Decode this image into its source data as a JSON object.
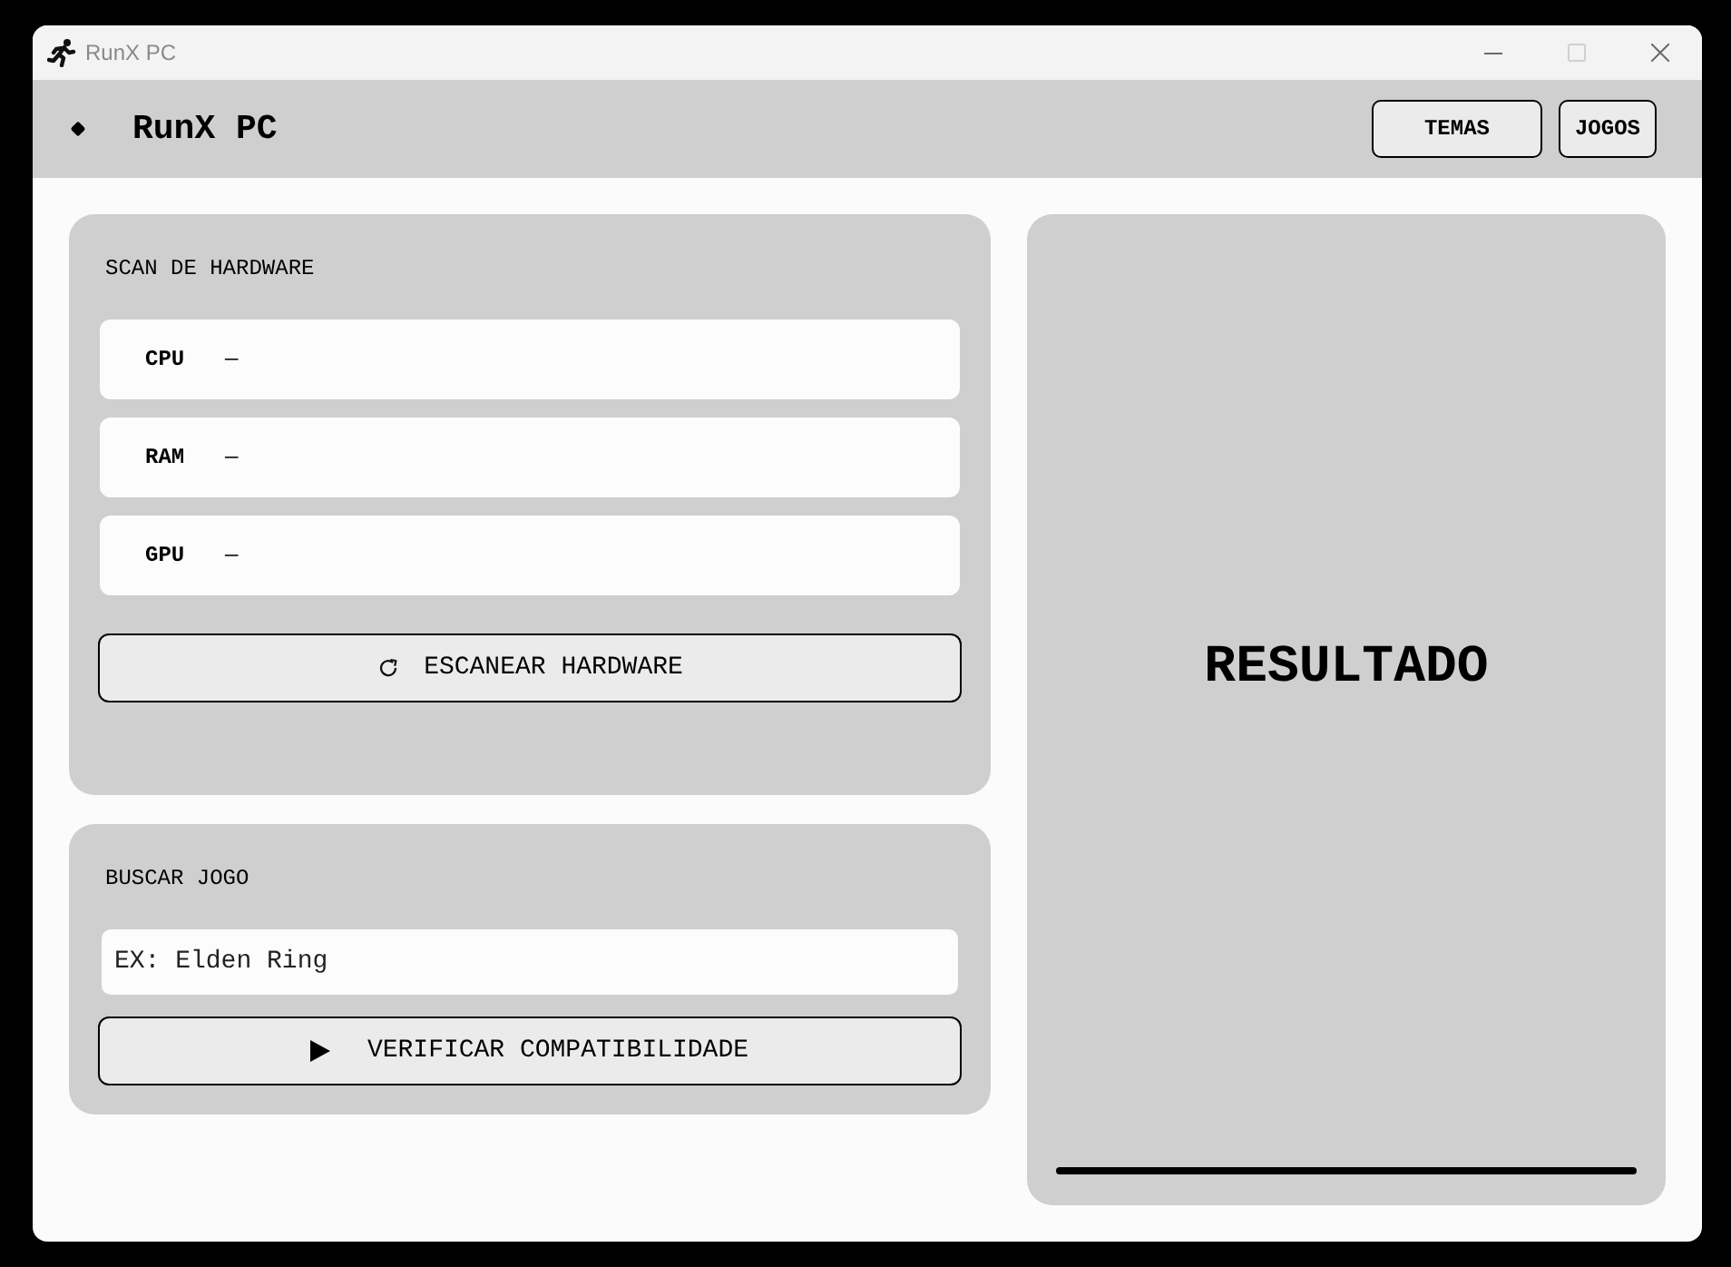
{
  "window": {
    "title": "RunX PC",
    "controls": [
      {
        "kind": "minimize",
        "disabled": false
      },
      {
        "kind": "maximize",
        "disabled": true
      },
      {
        "kind": "close",
        "disabled": false
      }
    ]
  },
  "header": {
    "title": "RunX PC",
    "buttons": [
      "TEMAS",
      "JOGOS"
    ]
  },
  "hardware_scan": {
    "title": "SCAN DE HARDWARE",
    "rows": [
      {
        "label": "CPU",
        "value": "—"
      },
      {
        "label": "RAM",
        "value": "—"
      },
      {
        "label": "GPU",
        "value": "—"
      }
    ],
    "button": "ESCANEAR HARDWARE"
  },
  "game_search": {
    "title": "BUSCAR JOGO",
    "placeholder": "EX: Elden Ring",
    "button": "VERIFICAR COMPATIBILIDADE"
  },
  "result": {
    "title": "RESULTADO"
  }
}
